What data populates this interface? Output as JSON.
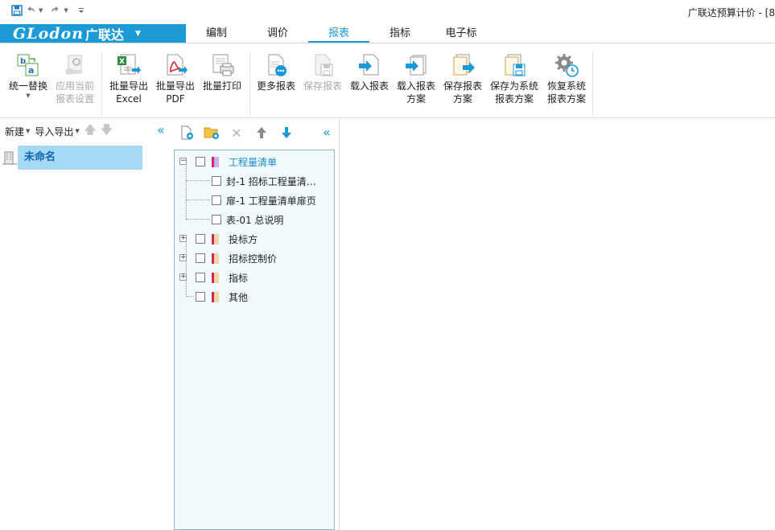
{
  "window": {
    "title": "广联达预算计价 - [8"
  },
  "quick_access": {
    "icons": [
      "save-icon",
      "undo-icon",
      "redo-icon",
      "customize-icon"
    ]
  },
  "logo": {
    "brand": "GLodon",
    "cn": "广联达"
  },
  "tabs": [
    {
      "label": "编制",
      "active": false
    },
    {
      "label": "调价",
      "active": false
    },
    {
      "label": "报表",
      "active": true
    },
    {
      "label": "指标",
      "active": false
    },
    {
      "label": "电子标",
      "active": false
    }
  ],
  "ribbon": {
    "unify_replace": {
      "line1": "统一替换",
      "line2": ""
    },
    "apply_settings": {
      "line1": "应用当前",
      "line2": "报表设置"
    },
    "export_excel": {
      "line1": "批量导出",
      "line2": "Excel"
    },
    "export_pdf": {
      "line1": "批量导出",
      "line2": "PDF"
    },
    "batch_print": {
      "line1": "批量打印",
      "line2": ""
    },
    "more_reports": {
      "line1": "更多报表",
      "line2": ""
    },
    "save_report": {
      "line1": "保存报表",
      "line2": ""
    },
    "load_report": {
      "line1": "载入报表",
      "line2": ""
    },
    "load_scheme": {
      "line1": "载入报表",
      "line2": "方案"
    },
    "save_scheme": {
      "line1": "保存报表",
      "line2": "方案"
    },
    "save_sys_scheme": {
      "line1": "保存为系统",
      "line2": "报表方案"
    },
    "restore_sys_scheme": {
      "line1": "恢复系统",
      "line2": "报表方案"
    }
  },
  "left_panel": {
    "new_label": "新建",
    "import_export_label": "导入导出",
    "project_name": "未命名"
  },
  "tree": {
    "root": "工程量清单",
    "children": [
      "封-1 招标工程量清…",
      "扉-1 工程量清单扉页",
      "表-01 总说明"
    ],
    "groups": [
      "投标方",
      "招标控制价",
      "指标",
      "其他"
    ]
  },
  "colors": {
    "accent": "#1a9ad6",
    "selection": "#a6d8f8",
    "tree_bg": "#f1fafd"
  }
}
